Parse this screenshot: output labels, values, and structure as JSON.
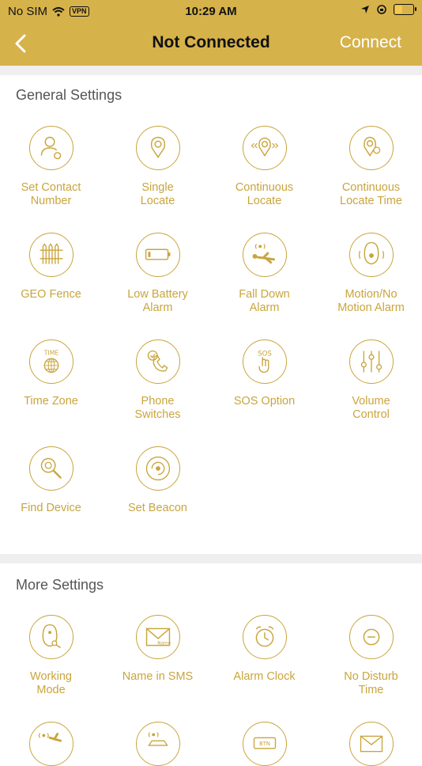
{
  "status_bar": {
    "carrier": "No SIM",
    "vpn": "VPN",
    "time": "10:29 AM"
  },
  "nav": {
    "title": "Not Connected",
    "connect_label": "Connect"
  },
  "general": {
    "title": "General Settings",
    "items": [
      {
        "label": "Set Contact\nNumber",
        "icon": "contact-settings-icon"
      },
      {
        "label": "Single\nLocate",
        "icon": "location-pin-icon"
      },
      {
        "label": "Continuous\nLocate",
        "icon": "continuous-location-icon"
      },
      {
        "label": "Continuous\nLocate Time",
        "icon": "location-time-icon"
      },
      {
        "label": "GEO Fence",
        "icon": "fence-icon"
      },
      {
        "label": "Low Battery\nAlarm",
        "icon": "low-battery-icon"
      },
      {
        "label": "Fall Down\nAlarm",
        "icon": "fall-down-icon"
      },
      {
        "label": "Motion/No\nMotion Alarm",
        "icon": "motion-device-icon"
      },
      {
        "label": "Time Zone",
        "icon": "time-globe-icon"
      },
      {
        "label": "Phone\nSwitches",
        "icon": "phone-check-icon"
      },
      {
        "label": "SOS Option",
        "icon": "sos-hand-icon"
      },
      {
        "label": "Volume\nControl",
        "icon": "volume-sliders-icon"
      },
      {
        "label": "Find Device",
        "icon": "find-device-icon"
      },
      {
        "label": "Set Beacon",
        "icon": "beacon-icon"
      }
    ]
  },
  "more": {
    "title": "More Settings",
    "items": [
      {
        "label": "Working\nMode",
        "icon": "working-mode-icon"
      },
      {
        "label": "Name in SMS",
        "icon": "sms-envelope-icon"
      },
      {
        "label": "Alarm Clock",
        "icon": "alarm-clock-icon"
      },
      {
        "label": "No Disturb\nTime",
        "icon": "no-disturb-icon"
      },
      {
        "label": "",
        "icon": "fall-signal-icon"
      },
      {
        "label": "",
        "icon": "car-signal-icon"
      },
      {
        "label": "",
        "icon": "button-settings-icon"
      },
      {
        "label": "",
        "icon": "mail-lock-icon"
      }
    ]
  },
  "icon_text": {
    "time": "TIME",
    "sos": "SOS",
    "name": "Name",
    "btn": "BTN"
  },
  "colors": {
    "brand": "#d6b24a",
    "accent": "#c9a53d",
    "divider": "#efefef"
  }
}
